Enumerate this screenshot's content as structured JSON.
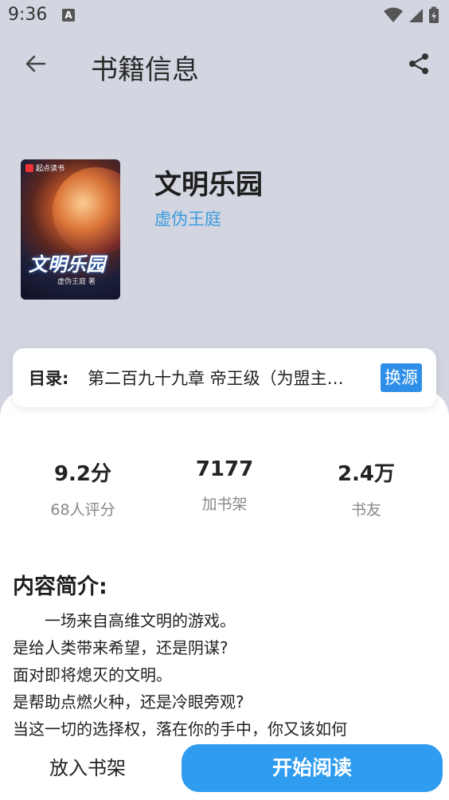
{
  "status_bar": {
    "time": "9:36",
    "notif_letter": "A"
  },
  "header": {
    "title": "书籍信息"
  },
  "book": {
    "cover_title": "文明乐园",
    "cover_author": "虚伪王庭 著",
    "cover_brand": "起点读书",
    "title": "文明乐园",
    "author": "虚伪王庭"
  },
  "toc": {
    "label": "目录:",
    "chapter": "第二百九十九章 帝王级（为盟主…",
    "swap_label": "换源"
  },
  "stats": [
    {
      "value": "9.2分",
      "label": "68人评分"
    },
    {
      "value": "7177",
      "label": "加书架"
    },
    {
      "value": "2.4万",
      "label": "书友"
    }
  ],
  "intro": {
    "heading": "内容简介:",
    "lines": [
      "　　一场来自高维文明的游戏。",
      "是给人类带来希望，还是阴谋?",
      "面对即将熄灭的文明。",
      "是帮助点燃火种，还是冷眼旁观?",
      "当这一切的选择权，落在你的手中，你又该如何"
    ]
  },
  "bottom": {
    "shelf_label": "放入书架",
    "read_label": "开始阅读"
  },
  "colors": {
    "accent": "#2f9cf0",
    "author_link": "#3a9be0",
    "background": "#d3d6e1"
  }
}
